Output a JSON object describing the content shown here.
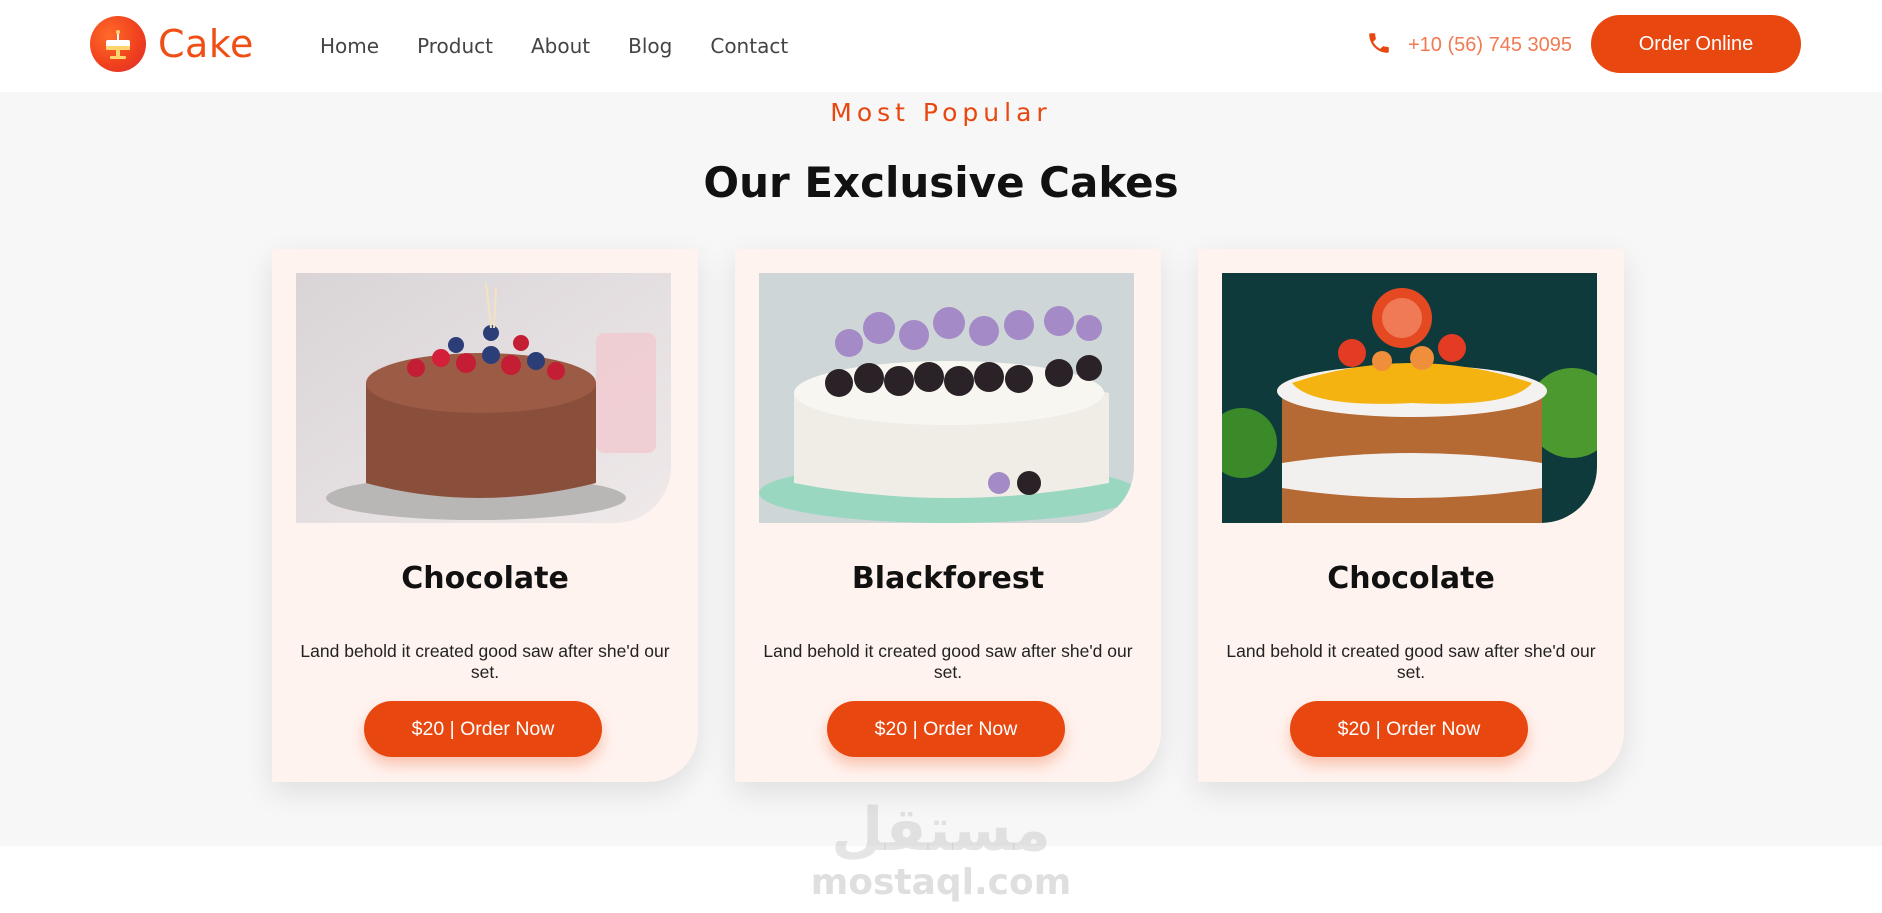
{
  "header": {
    "logo_text": "Cake",
    "logo_icon": "cake-icon",
    "nav": [
      "Home",
      "Product",
      "About",
      "Blog",
      "Contact"
    ],
    "phone_icon": "phone-icon",
    "phone": "+10 (56) 745 3095",
    "cta_label": "Order Online"
  },
  "section": {
    "eyebrow": "Most Popular",
    "title": "Our Exclusive Cakes",
    "cards": [
      {
        "title": "Chocolate",
        "description": "Land behold it created good saw after she'd our set.",
        "button_label": "$20 | Order Now"
      },
      {
        "title": "Blackforest",
        "description": "Land behold it created good saw after she'd our set.",
        "button_label": "$20 | Order Now"
      },
      {
        "title": "Chocolate",
        "description": "Land behold it created good saw after she'd our set.",
        "button_label": "$20 | Order Now"
      }
    ]
  },
  "watermark": {
    "arabic": "مستقل",
    "latin": "mostaql.com"
  },
  "colors": {
    "brand": "#e8470f",
    "accent_text": "#f07a52",
    "card_bg": "#fff3ef",
    "section_bg": "#f7f7f7"
  }
}
